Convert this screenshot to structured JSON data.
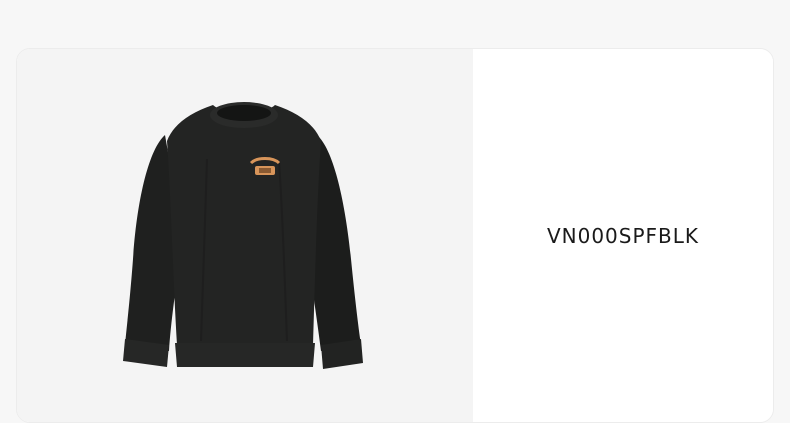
{
  "product": {
    "sku": "VN000SPFBLK",
    "image_icon": "sweatshirt-image",
    "garment_color": "#1f201f",
    "patch_color": "#d8955a"
  }
}
